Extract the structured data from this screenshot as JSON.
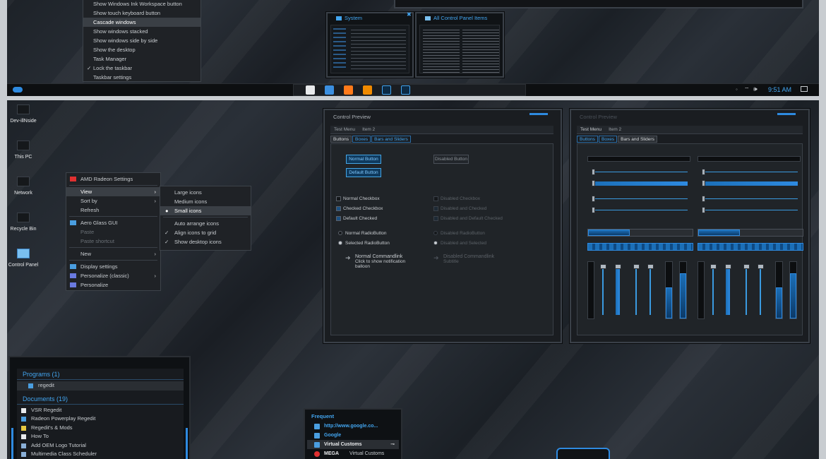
{
  "top_section": {
    "taskbar_menu": {
      "items": [
        {
          "label": "Show Windows Ink Workspace button",
          "highlighted": false,
          "checked": false
        },
        {
          "label": "Show touch keyboard button",
          "highlighted": false,
          "checked": false
        },
        {
          "label": "Cascade windows",
          "highlighted": true,
          "checked": false
        },
        {
          "label": "Show windows stacked",
          "highlighted": false,
          "checked": false
        },
        {
          "label": "Show windows side by side",
          "highlighted": false,
          "checked": false
        },
        {
          "label": "Show the desktop",
          "highlighted": false,
          "checked": false
        },
        {
          "label": "Task Manager",
          "highlighted": false,
          "checked": false
        },
        {
          "label": "Lock the taskbar",
          "highlighted": false,
          "checked": true
        },
        {
          "label": "Taskbar settings",
          "highlighted": false,
          "checked": false
        }
      ]
    },
    "thumbnails": [
      {
        "title": "System"
      },
      {
        "title": "All Control Panel Items"
      }
    ],
    "clock": "9:51 AM",
    "taskbar_icons": [
      "store-icon",
      "edge-icon",
      "firefox-icon",
      "vlc-icon",
      "photoshop-icon",
      "control-panel-icon"
    ]
  },
  "desktop_icons": [
    {
      "label": "Dev-illNside",
      "icon": "folder-icon"
    },
    {
      "label": "This PC",
      "icon": "computer-icon"
    },
    {
      "label": "Network",
      "icon": "network-icon"
    },
    {
      "label": "Recycle Bin",
      "icon": "recycle-bin-icon"
    },
    {
      "label": "Control Panel",
      "icon": "control-panel-icon"
    }
  ],
  "context_menu": {
    "items": [
      {
        "label": "AMD Radeon Settings",
        "icon": "amd-icon",
        "disabled": false
      },
      {
        "label": "View",
        "submenu": true,
        "highlighted": true
      },
      {
        "label": "Sort by",
        "submenu": true
      },
      {
        "label": "Refresh"
      },
      {
        "label": "Aero Glass GUI",
        "icon": "aero-icon"
      },
      {
        "label": "Paste",
        "disabled": true
      },
      {
        "label": "Paste shortcut",
        "disabled": true
      },
      {
        "label": "New",
        "submenu": true
      },
      {
        "label": "Display settings",
        "icon": "display-icon"
      },
      {
        "label": "Personalize (classic)",
        "icon": "personalize-icon",
        "submenu": true
      },
      {
        "label": "Personalize",
        "icon": "personalize-icon"
      }
    ],
    "view_submenu": [
      {
        "label": "Large icons"
      },
      {
        "label": "Medium icons"
      },
      {
        "label": "Small icons",
        "selected": true
      },
      {
        "label": "Auto arrange icons"
      },
      {
        "label": "Align icons to grid",
        "checked": true
      },
      {
        "label": "Show desktop icons",
        "checked": true
      }
    ]
  },
  "control_preview_1": {
    "title": "Control Preview",
    "menu": [
      "Test Menu",
      "Item 2"
    ],
    "tabs": [
      {
        "label": "Buttons",
        "active": true
      },
      {
        "label": "Boxes"
      },
      {
        "label": "Bars and Sliders"
      }
    ],
    "buttons": {
      "normal": "Normal Button",
      "default": "Default Button",
      "disabled": "Disabled Button"
    },
    "checkboxes": [
      "Normal Checkbox",
      "Checked Checkbox",
      "Default Checked"
    ],
    "disabled_checkboxes": [
      "Disabled Checkbox",
      "Disabled and Checked",
      "Disabled and Default Checked"
    ],
    "radios": [
      "Normal RadioButton",
      "Selected RadioButton"
    ],
    "disabled_radios": [
      "Disabled RadioButton",
      "Disabled and Selected"
    ],
    "commandlink": {
      "title": "Normal Commandlink",
      "subtitle": "Click to show notification balloon"
    },
    "disabled_commandlink": {
      "title": "Disabled Commandlink",
      "subtitle": "Subtitle"
    }
  },
  "control_preview_2": {
    "title": "Control Preview",
    "menu": [
      "Test Menu",
      "Item 2"
    ],
    "tabs": [
      {
        "label": "Buttons"
      },
      {
        "label": "Boxes"
      },
      {
        "label": "Bars and Sliders",
        "active": true
      }
    ],
    "progress_levels": [
      0.4,
      0.55,
      0.8
    ]
  },
  "start_menu": {
    "groups": [
      {
        "title": "Programs (1)",
        "items": [
          "regedit"
        ]
      },
      {
        "title": "Documents (19)",
        "items": [
          "VSR Regedit",
          "Radeon Powerplay Regedit",
          "Regedit's & Mods",
          "How To",
          "Add OEM Logo Tutorial",
          "Multimedia Class Scheduler"
        ]
      }
    ]
  },
  "jumplist": {
    "heading": "Frequent",
    "items": [
      "http://www.google.co...",
      "Google",
      "Virtual Customs",
      "MEGA"
    ],
    "footer": "Virtual Customs"
  },
  "colors": {
    "accent": "#42a5f0",
    "panel": "#1b1e22",
    "border": "#3a4048",
    "frame": "#c9cdd1"
  }
}
